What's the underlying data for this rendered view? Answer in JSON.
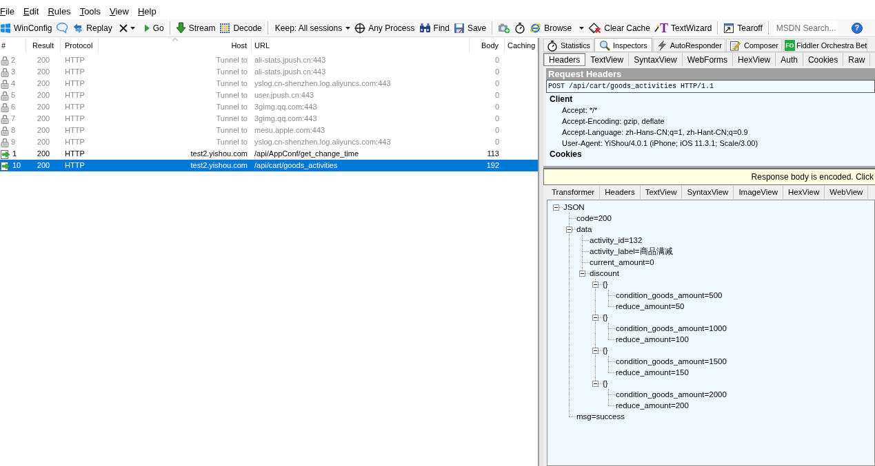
{
  "menu": [
    {
      "label": "File"
    },
    {
      "label": "Edit"
    },
    {
      "label": "Rules"
    },
    {
      "label": "Tools"
    },
    {
      "label": "View"
    },
    {
      "label": "Help"
    }
  ],
  "toolbar": [
    {
      "kind": "button",
      "label": "WinConfig"
    },
    {
      "kind": "icon"
    },
    {
      "kind": "button",
      "label": "Replay"
    },
    {
      "kind": "icon_menu"
    },
    {
      "kind": "button",
      "label": "Go"
    },
    {
      "kind": "separator"
    },
    {
      "kind": "button",
      "label": "Stream"
    },
    {
      "kind": "button",
      "label": "Decode"
    },
    {
      "kind": "separator"
    },
    {
      "kind": "menu",
      "label": "Keep: All sessions"
    },
    {
      "kind": "button",
      "label": "Any Process"
    },
    {
      "kind": "button",
      "label": "Find"
    },
    {
      "kind": "button",
      "label": "Save"
    },
    {
      "kind": "separator"
    },
    {
      "kind": "icon"
    },
    {
      "kind": "icon"
    },
    {
      "kind": "split",
      "label": "Browse"
    },
    {
      "kind": "button",
      "label": "Clear Cache"
    },
    {
      "kind": "button",
      "label": "TextWizard",
      "glyph": "T"
    },
    {
      "kind": "separator"
    },
    {
      "kind": "button",
      "label": "Tearoff"
    },
    {
      "kind": "separator"
    },
    {
      "kind": "search",
      "placeholder": "MSDN Search..."
    },
    {
      "kind": "icon",
      "glyph": "?"
    }
  ],
  "sessions": {
    "columns": [
      {
        "label": "#",
        "sorted": false
      },
      {
        "label": "Result",
        "sorted": false
      },
      {
        "label": "Protocol",
        "sorted": false
      },
      {
        "label": "Host",
        "sorted": true
      },
      {
        "label": "URL",
        "sorted": false
      },
      {
        "label": "Body",
        "sorted": false
      },
      {
        "label": "Caching",
        "sorted": false
      }
    ],
    "rows": [
      {
        "kind": "tunnel",
        "selected": false,
        "num": "2",
        "result": "200",
        "protocol": "HTTP",
        "host": "Tunnel to",
        "url": "ali-stats.jpush.cn:443",
        "body": "0"
      },
      {
        "kind": "tunnel",
        "selected": false,
        "num": "3",
        "result": "200",
        "protocol": "HTTP",
        "host": "Tunnel to",
        "url": "ali-stats.jpush.cn:443",
        "body": "0"
      },
      {
        "kind": "tunnel",
        "selected": false,
        "num": "4",
        "result": "200",
        "protocol": "HTTP",
        "host": "Tunnel to",
        "url": "yslog.cn-shenzhen.log.aliyuncs.com:443",
        "body": "0"
      },
      {
        "kind": "tunnel",
        "selected": false,
        "num": "5",
        "result": "200",
        "protocol": "HTTP",
        "host": "Tunnel to",
        "url": "user.jpush.cn:443",
        "body": "0"
      },
      {
        "kind": "tunnel",
        "selected": false,
        "num": "6",
        "result": "200",
        "protocol": "HTTP",
        "host": "Tunnel to",
        "url": "3gimg.qq.com:443",
        "body": "0"
      },
      {
        "kind": "tunnel",
        "selected": false,
        "num": "7",
        "result": "200",
        "protocol": "HTTP",
        "host": "Tunnel to",
        "url": "3gimg.qq.com:443",
        "body": "0"
      },
      {
        "kind": "tunnel",
        "selected": false,
        "num": "8",
        "result": "200",
        "protocol": "HTTP",
        "host": "Tunnel to",
        "url": "mesu.apple.com:443",
        "body": "0"
      },
      {
        "kind": "tunnel",
        "selected": false,
        "num": "9",
        "result": "200",
        "protocol": "HTTP",
        "host": "Tunnel to",
        "url": "yslog.cn-shenzhen.log.aliyuncs.com:443",
        "body": "0"
      },
      {
        "kind": "request",
        "selected": false,
        "num": "1",
        "result": "200",
        "protocol": "HTTP",
        "host": "test2.yishou.com",
        "url": "/api/AppConf/get_change_time",
        "body": "113"
      },
      {
        "kind": "request",
        "selected": true,
        "num": "10",
        "result": "200",
        "protocol": "HTTP",
        "host": "test2.yishou.com",
        "url": "/api/cart/goods_activities",
        "body": "192"
      }
    ]
  },
  "inspector_tabs": [
    {
      "label": "Statistics",
      "selected": false
    },
    {
      "label": "Inspectors",
      "selected": true
    },
    {
      "label": "AutoResponder",
      "selected": false
    },
    {
      "label": "Composer",
      "selected": false
    },
    {
      "label": "Fiddler Orchestra Bet",
      "badge": "FO",
      "selected": false
    }
  ],
  "request": {
    "tabs": [
      {
        "label": "Headers",
        "selected": true
      },
      {
        "label": "TextView",
        "selected": false
      },
      {
        "label": "SyntaxView",
        "selected": false
      },
      {
        "label": "WebForms",
        "selected": false
      },
      {
        "label": "HexView",
        "selected": false
      },
      {
        "label": "Auth",
        "selected": false
      },
      {
        "label": "Cookies",
        "selected": false
      },
      {
        "label": "Raw",
        "selected": false
      }
    ],
    "title": "Request Headers",
    "request_line": "POST /api/cart/goods_activities HTTP/1.1",
    "groups": [
      {
        "name": "Client",
        "headers": [
          "Accept: */*",
          "Accept-Encoding: gzip, deflate",
          "Accept-Language: zh-Hans-CN;q=1, zh-Hant-CN;q=0.9",
          "User-Agent: YiShou/4.0.1 (iPhone; iOS 11.3.1; Scale/3.00)"
        ]
      },
      {
        "name": "Cookies"
      }
    ]
  },
  "response": {
    "notice": "Response body is encoded. Click",
    "tabs": [
      {
        "label": "Transformer",
        "selected": false
      },
      {
        "label": "Headers",
        "selected": false
      },
      {
        "label": "TextView",
        "selected": false
      },
      {
        "label": "SyntaxView",
        "selected": false
      },
      {
        "label": "ImageView",
        "selected": false
      },
      {
        "label": "HexView",
        "selected": false
      },
      {
        "label": "WebView",
        "selected": false
      }
    ],
    "tree": {
      "label": "JSON",
      "expanded": true,
      "children": [
        {
          "label": "code=200"
        },
        {
          "label": "data",
          "expanded": true,
          "children": [
            {
              "label": "activity_id=132"
            },
            {
              "label": "activity_label=商品满减"
            },
            {
              "label": "current_amount=0"
            },
            {
              "label": "discount",
              "expanded": true,
              "children": [
                {
                  "label": "{}",
                  "expanded": true,
                  "children": [
                    {
                      "label": "condition_goods_amount=500"
                    },
                    {
                      "label": "reduce_amount=50"
                    }
                  ]
                },
                {
                  "label": "{}",
                  "expanded": true,
                  "children": [
                    {
                      "label": "condition_goods_amount=1000"
                    },
                    {
                      "label": "reduce_amount=100"
                    }
                  ]
                },
                {
                  "label": "{}",
                  "expanded": true,
                  "children": [
                    {
                      "label": "condition_goods_amount=1500"
                    },
                    {
                      "label": "reduce_amount=150"
                    }
                  ]
                },
                {
                  "label": "{}",
                  "expanded": true,
                  "children": [
                    {
                      "label": "condition_goods_amount=2000"
                    },
                    {
                      "label": "reduce_amount=200"
                    }
                  ]
                }
              ]
            }
          ]
        },
        {
          "label": "msg=success"
        }
      ]
    }
  }
}
